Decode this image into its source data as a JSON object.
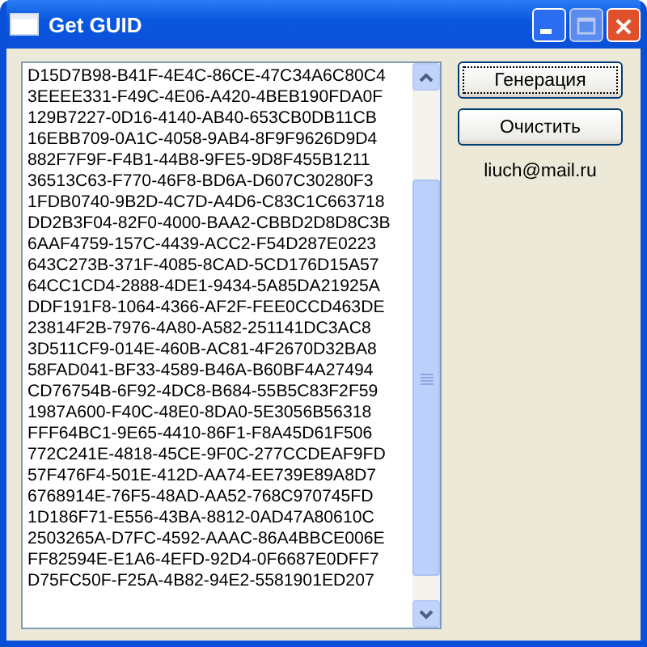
{
  "window": {
    "title": "Get GUID"
  },
  "guids": [
    "D15D7B98-B41F-4E4C-86CE-47C34A6C80C4",
    "3EEEE331-F49C-4E06-A420-4BEB190FDA0F",
    "129B7227-0D16-4140-AB40-653CB0DB11CB",
    "16EBB709-0A1C-4058-9AB4-8F9F9626D9D4",
    "882F7F9F-F4B1-44B8-9FE5-9D8F455B1211",
    "36513C63-F770-46F8-BD6A-D607C30280F3",
    "1FDB0740-9B2D-4C7D-A4D6-C83C1C663718",
    "DD2B3F04-82F0-4000-BAA2-CBBD2D8D8C3B",
    "6AAF4759-157C-4439-ACC2-F54D287E0223",
    "643C273B-371F-4085-8CAD-5CD176D15A57",
    "64CC1CD4-2888-4DE1-9434-5A85DA21925A",
    "DDF191F8-1064-4366-AF2F-FEE0CCD463DE",
    "23814F2B-7976-4A80-A582-251141DC3AC8",
    "3D511CF9-014E-460B-AC81-4F2670D32BA8",
    "58FAD041-BF33-4589-B46A-B60BF4A27494",
    "CD76754B-6F92-4DC8-B684-55B5C83F2F59",
    "1987A600-F40C-48E0-8DA0-5E3056B56318",
    "FFF64BC1-9E65-4410-86F1-F8A45D61F506",
    "772C241E-4818-45CE-9F0C-277CCDEAF9FD",
    "57F476F4-501E-412D-AA74-EE739E89A8D7",
    "6768914E-76F5-48AD-AA52-768C970745FD",
    "1D186F71-E556-43BA-8812-0AD47A80610C",
    "2503265A-D7FC-4592-AAAC-86A4BBCE006E",
    "FF82594E-E1A6-4EFD-92D4-0F6687E0DFF7",
    "D75FC50F-F25A-4B82-94E2-5581901ED207"
  ],
  "buttons": [
    {
      "label": "Генерация",
      "focused": true
    },
    {
      "label": "Очистить",
      "focused": false
    }
  ],
  "email": "liuch@mail.ru"
}
